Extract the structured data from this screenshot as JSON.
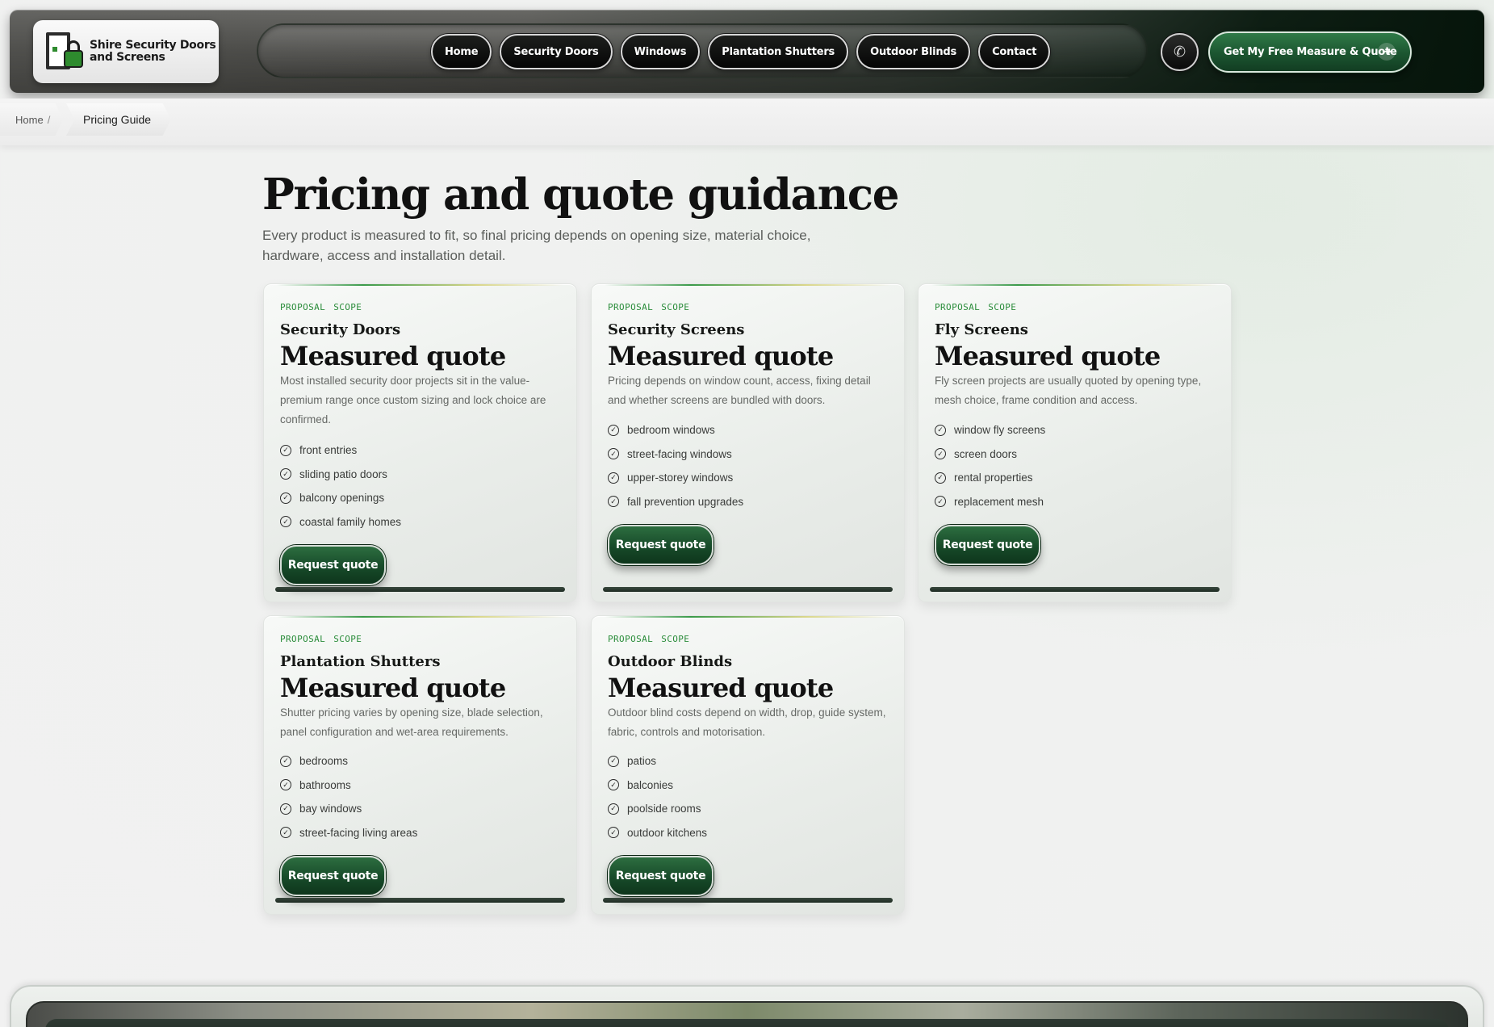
{
  "brand": {
    "name_line1": "Shire Security Doors",
    "name_line2": "and Screens"
  },
  "nav": {
    "items": [
      {
        "label": "Home"
      },
      {
        "label": "Security Doors"
      },
      {
        "label": "Windows"
      },
      {
        "label": "Plantation Shutters"
      },
      {
        "label": "Outdoor Blinds"
      },
      {
        "label": "Contact"
      }
    ],
    "phone_icon": "phone-icon",
    "cta_label": "Get My Free Measure & Quote",
    "cta_icon": "arrow-right-icon"
  },
  "breadcrumb": {
    "home": "Home",
    "separator": "/",
    "current": "Pricing Guide"
  },
  "page": {
    "title": "Pricing and quote guidance",
    "subtitle": "Every product is measured to fit, so final pricing depends on opening size, material choice, hardware, access and installation detail."
  },
  "cards": [
    {
      "tag": "PROPOSAL SCOPE",
      "title": "Security Doors",
      "price": "Measured quote",
      "desc": "Most installed security door projects sit in the value-premium range once custom sizing and lock choice are confirmed.",
      "items": [
        "front entries",
        "sliding patio doors",
        "balcony openings",
        "coastal family homes"
      ],
      "button": "Request quote"
    },
    {
      "tag": "PROPOSAL SCOPE",
      "title": "Security Screens",
      "price": "Measured quote",
      "desc": "Pricing depends on window count, access, fixing detail and whether screens are bundled with doors.",
      "items": [
        "bedroom windows",
        "street-facing windows",
        "upper-storey windows",
        "fall prevention upgrades"
      ],
      "button": "Request quote"
    },
    {
      "tag": "PROPOSAL SCOPE",
      "title": "Fly Screens",
      "price": "Measured quote",
      "desc": "Fly screen projects are usually quoted by opening type, mesh choice, frame condition and access.",
      "items": [
        "window fly screens",
        "screen doors",
        "rental properties",
        "replacement mesh"
      ],
      "button": "Request quote"
    },
    {
      "tag": "PROPOSAL SCOPE",
      "title": "Plantation Shutters",
      "price": "Measured quote",
      "desc": "Shutter pricing varies by opening size, blade selection, panel configuration and wet-area requirements.",
      "items": [
        "bedrooms",
        "bathrooms",
        "bay windows",
        "street-facing living areas"
      ],
      "button": "Request quote"
    },
    {
      "tag": "PROPOSAL SCOPE",
      "title": "Outdoor Blinds",
      "price": "Measured quote",
      "desc": "Outdoor blind costs depend on width, drop, guide system, fabric, controls and motorisation.",
      "items": [
        "patios",
        "balconies",
        "poolside rooms",
        "outdoor kitchens"
      ],
      "button": "Request quote"
    }
  ],
  "colors": {
    "accent_green": "#1b5530",
    "tag_green": "#2a8c3a",
    "header_dark": "#06150b"
  }
}
